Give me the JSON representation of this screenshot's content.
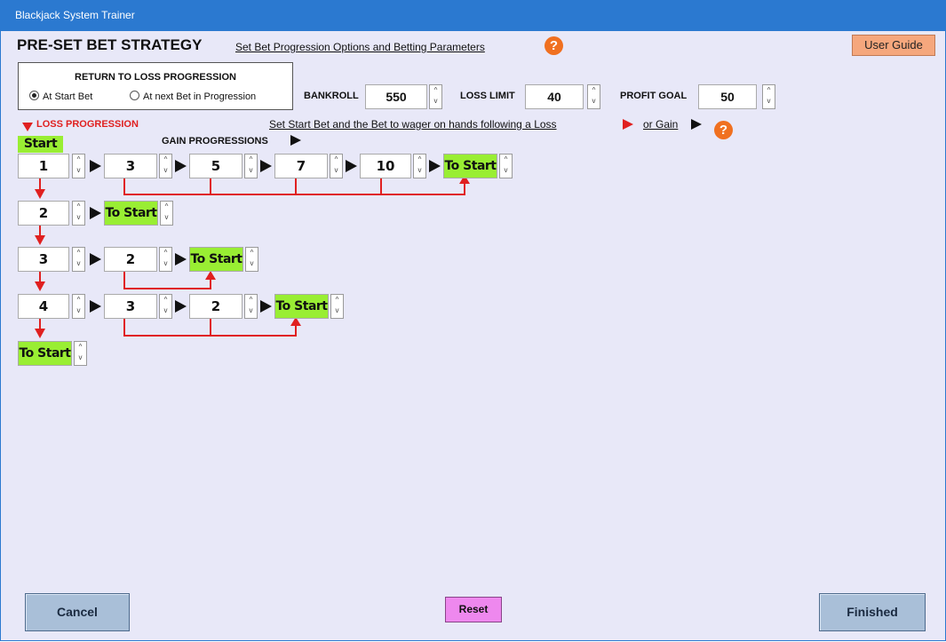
{
  "window": {
    "title": "Blackjack System Trainer"
  },
  "header": {
    "title": "PRE-SET BET STRATEGY",
    "link": "Set Bet Progression Options and Betting Parameters",
    "help_glyph": "?",
    "user_guide": "User Guide"
  },
  "return_to_loss": {
    "title": "RETURN TO LOSS PROGRESSION",
    "options": [
      {
        "label": "At Start Bet",
        "selected": true
      },
      {
        "label": "At next Bet in Progression",
        "selected": false
      }
    ]
  },
  "params": {
    "bankroll_label": "BANKROLL",
    "bankroll_value": "550",
    "loss_limit_label": "LOSS LIMIT",
    "loss_limit_value": "40",
    "profit_goal_label": "PROFIT GOAL",
    "profit_goal_value": "50"
  },
  "progression": {
    "loss_label": "LOSS PROGRESSION",
    "gain_label": "GAIN PROGRESSIONS",
    "instruction": "Set Start Bet and the Bet to wager on hands following a Loss",
    "or_gain": "or Gain",
    "start_label": "Start",
    "spin_up": "^",
    "spin_down": "v",
    "rows": [
      {
        "loss": "1",
        "gains": [
          "3",
          "5",
          "7",
          "10"
        ],
        "end": "To Start"
      },
      {
        "loss": "2",
        "gains": [],
        "end": "To Start"
      },
      {
        "loss": "3",
        "gains": [
          "2"
        ],
        "end": "To Start"
      },
      {
        "loss": "4",
        "gains": [
          "3",
          "2"
        ],
        "end": "To Start"
      }
    ],
    "final": "To Start"
  },
  "footer": {
    "cancel": "Cancel",
    "reset": "Reset",
    "finished": "Finished"
  },
  "colors": {
    "titlebar": "#2b79d0",
    "background": "#e8e8f8",
    "start_green": "#99ee33",
    "loss_red": "#e02020",
    "help_orange": "#f07020",
    "user_guide": "#f5a77d",
    "reset_pink": "#ee88ee",
    "button_blue": "#a9bfd8"
  }
}
